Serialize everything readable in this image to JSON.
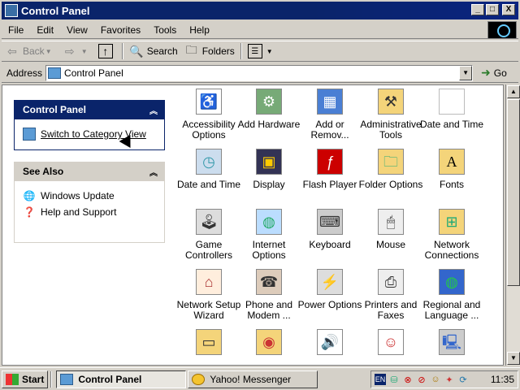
{
  "window": {
    "title": "Control Panel",
    "buttons": {
      "minimize": "_",
      "maximize": "□",
      "close": "X"
    }
  },
  "menu": [
    "File",
    "Edit",
    "View",
    "Favorites",
    "Tools",
    "Help"
  ],
  "toolbar": {
    "back": "Back",
    "search": "Search",
    "folders": "Folders"
  },
  "address": {
    "label": "Address",
    "value": "Control Panel",
    "go": "Go"
  },
  "left_pane": {
    "control_panel": {
      "title": "Control Panel",
      "link": "Switch to Category View"
    },
    "see_also": {
      "title": "See Also",
      "links": [
        "Windows Update",
        "Help and Support"
      ]
    }
  },
  "items": [
    {
      "name": "Accessibility Options",
      "icon": "wheelchair-icon"
    },
    {
      "name": "Add Hardware",
      "icon": "hardware-icon"
    },
    {
      "name": "Add or Remov...",
      "icon": "programs-icon"
    },
    {
      "name": "Administrative Tools",
      "icon": "tools-icon"
    },
    {
      "name": "Date and Time",
      "icon": "document-icon"
    },
    {
      "name": "Date and Time",
      "icon": "clock-icon"
    },
    {
      "name": "Display",
      "icon": "display-icon"
    },
    {
      "name": "Flash Player",
      "icon": "flash-icon"
    },
    {
      "name": "Folder Options",
      "icon": "folder-icon"
    },
    {
      "name": "Fonts",
      "icon": "fonts-icon"
    },
    {
      "name": "Game Controllers",
      "icon": "joystick-icon"
    },
    {
      "name": "Internet Options",
      "icon": "globe-icon"
    },
    {
      "name": "Keyboard",
      "icon": "keyboard-icon"
    },
    {
      "name": "Mouse",
      "icon": "mouse-icon"
    },
    {
      "name": "Network Connections",
      "icon": "network-icon"
    },
    {
      "name": "Network Setup Wizard",
      "icon": "house-icon"
    },
    {
      "name": "Phone and Modem ...",
      "icon": "phone-icon"
    },
    {
      "name": "Power Options",
      "icon": "power-icon"
    },
    {
      "name": "Printers and Faxes",
      "icon": "printer-icon"
    },
    {
      "name": "Regional and Language ...",
      "icon": "globe-icon"
    },
    {
      "name": "",
      "icon": "folder-icon"
    },
    {
      "name": "",
      "icon": "scheduled-tasks-icon"
    },
    {
      "name": "",
      "icon": "sound-icon"
    },
    {
      "name": "",
      "icon": "user-icon"
    },
    {
      "name": "",
      "icon": "computer-icon"
    }
  ],
  "taskbar": {
    "start": "Start",
    "tasks": [
      "Control Panel",
      "Yahoo! Messenger"
    ],
    "tray_lang": "EN",
    "clock": "11:35"
  }
}
